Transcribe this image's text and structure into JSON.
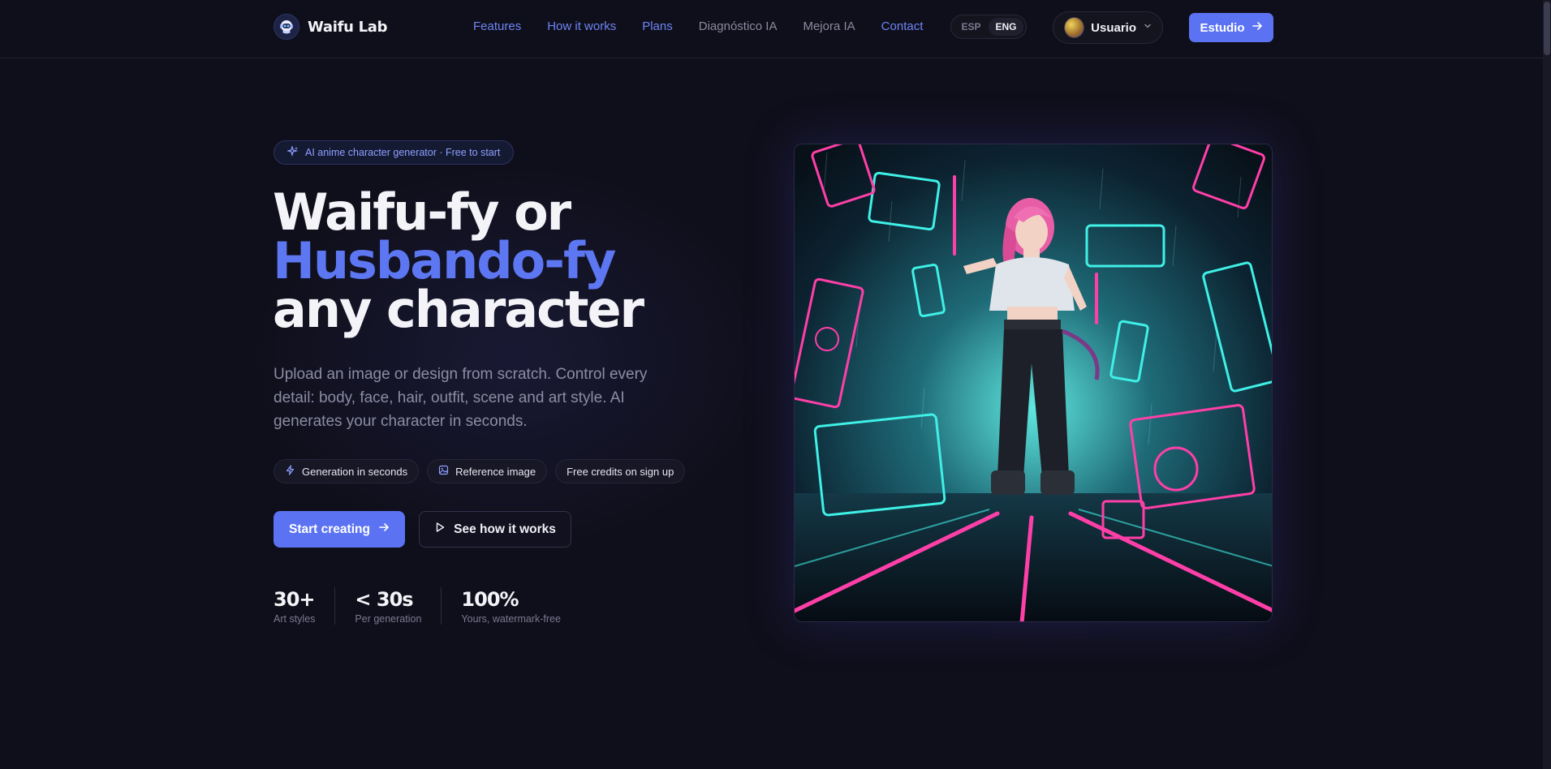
{
  "brand": {
    "name": "Waifu Lab",
    "logo_icon": "robot-mascot-icon"
  },
  "nav": {
    "links": [
      {
        "label": "Features",
        "style": "accent"
      },
      {
        "label": "How it works",
        "style": "accent"
      },
      {
        "label": "Plans",
        "style": "accent"
      },
      {
        "label": "Diagnóstico IA",
        "style": "muted"
      },
      {
        "label": "Mejora IA",
        "style": "muted"
      },
      {
        "label": "Contact",
        "style": "accent"
      }
    ],
    "language": {
      "options": [
        "ESP",
        "ENG"
      ],
      "selected": "ENG"
    },
    "user": {
      "name": "Usuario"
    },
    "studio_button": "Estudio"
  },
  "hero": {
    "badge": "AI anime character generator · Free to start",
    "headline": {
      "line1": "Waifu-fy or",
      "line2": "Husbando-fy",
      "line3": "any character"
    },
    "description": "Upload an image or design from scratch. Control every detail: body, face, hair, outfit, scene and art style. AI generates your character in seconds.",
    "features": [
      {
        "label": "Generation in seconds",
        "icon": "lightning-icon"
      },
      {
        "label": "Reference image",
        "icon": "image-icon"
      },
      {
        "label": "Free credits on sign up",
        "icon": ""
      }
    ],
    "primary_cta": "Start creating",
    "secondary_cta": "See how it works",
    "stats": [
      {
        "value": "30+",
        "label": "Art styles"
      },
      {
        "value": "< 30s",
        "label": "Per generation"
      },
      {
        "value": "100%",
        "label": "Yours, watermark-free"
      }
    ],
    "image": {
      "subject": "anime-character-neon-city"
    }
  },
  "colors": {
    "background": "#0f0f1b",
    "accent": "#5b73f2",
    "accent_text": "#6f84f5",
    "muted_text": "#8c8ca4",
    "neon_pink": "#ff3fa8",
    "neon_cyan": "#3ff0e6"
  }
}
